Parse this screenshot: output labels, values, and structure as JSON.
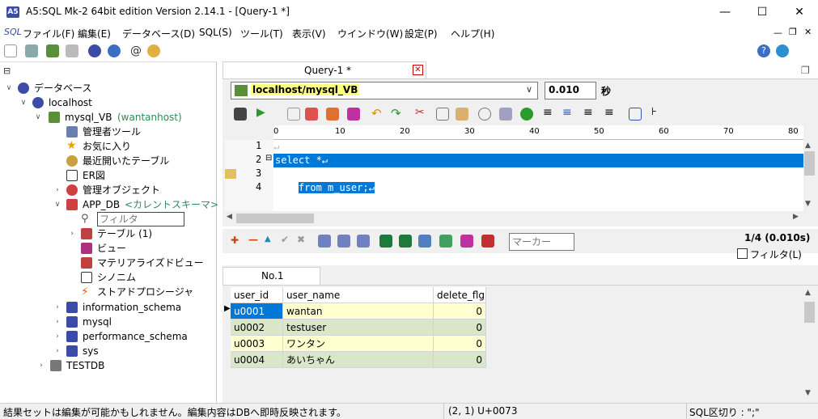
{
  "window": {
    "logo_text": "A5",
    "title": "A5:SQL Mk-2 64bit edition Version 2.14.1 - [Query-1 *]",
    "minimize": "—",
    "maximize": "☐",
    "close": "✕"
  },
  "menu": {
    "sql_label": "SQL",
    "items": [
      "ファイル(F)",
      "編集(E)",
      "データベース(D)",
      "SQL(S)",
      "ツール(T)",
      "表示(V)",
      "ウインドウ(W)",
      "設定(P)",
      "ヘルプ(H)"
    ]
  },
  "tree": {
    "root": "データベース",
    "localhost": "localhost",
    "db": "mysql_VB",
    "db_user": "(wantanhost)",
    "admin_tools": "管理者ツール",
    "favorites": "お気に入り",
    "recent_tables": "最近開いたテーブル",
    "er": "ER図",
    "mgmt_objects": "管理オブジェクト",
    "app_db": "APP_DB",
    "current_schema": "<カレントスキーマ>",
    "filter_placeholder": "フィルタ",
    "tables": "テーブル (1)",
    "views": "ビュー",
    "mat_views": "マテリアライズドビュー",
    "synonyms": "シノニム",
    "stored_procs": "ストアドプロシージャ",
    "information_schema": "information_schema",
    "mysql": "mysql",
    "performance_schema": "performance_schema",
    "sys": "sys",
    "testdb": "TESTDB"
  },
  "editor": {
    "tab_label": "Query-1 *",
    "connection": "localhost/mysql_VB",
    "elapsed": "0.010",
    "elapsed_unit": "秒",
    "ruler_ticks": [
      "0",
      "10",
      "20",
      "30",
      "40",
      "50",
      "60",
      "70",
      "80"
    ],
    "line_numbers": [
      "1",
      "2",
      "3",
      "4"
    ],
    "lines": [
      "",
      "select *↵",
      "from m_user;↵",
      ""
    ]
  },
  "results": {
    "marker_placeholder": "マーカー",
    "count": "1/4 (0.010s)",
    "filter_label": "フィルタ(L)",
    "tab_label": "No.1",
    "columns": [
      "user_id",
      "user_name",
      "delete_flg"
    ],
    "rows": [
      [
        "u0001",
        "wantan",
        "0"
      ],
      [
        "u0002",
        "testuser",
        "0"
      ],
      [
        "u0003",
        "ワンタン",
        "0"
      ],
      [
        "u0004",
        "あいちゃん",
        "0"
      ]
    ]
  },
  "status": {
    "message": "結果セットは編集が可能かもしれません。編集内容はDBへ即時反映されます。",
    "position": "(2, 1) U+0073",
    "delimiter": "SQL区切り : \";\""
  },
  "colors": {
    "selection": "#0078d7",
    "row_odd": "#ffffd0",
    "row_even": "#d9e6c9",
    "schema_green": "#2e8b57"
  }
}
